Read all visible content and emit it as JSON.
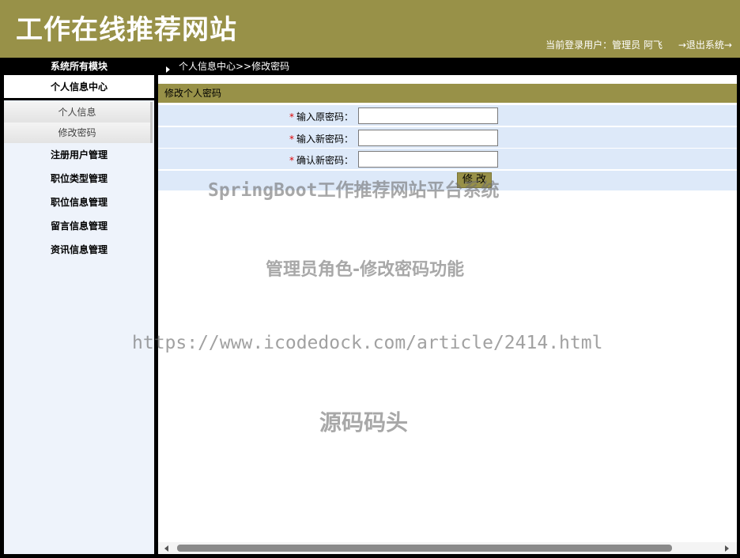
{
  "header": {
    "site_title": "工作在线推荐网站",
    "user_info": "当前登录用户：管理员 阿飞",
    "logout": "→退出系统→"
  },
  "sidebar": {
    "title": "系统所有模块",
    "active_group": "个人信息中心",
    "sub_items": [
      "个人信息",
      "修改密码"
    ],
    "groups": [
      "注册用户管理",
      "职位类型管理",
      "职位信息管理",
      "留言信息管理",
      "资讯信息管理"
    ]
  },
  "breadcrumb": "个人信息中心>>修改密码",
  "form": {
    "title": "修改个人密码",
    "required_mark": "*",
    "fields": [
      {
        "label": "输入原密码：",
        "value": ""
      },
      {
        "label": "输入新密码：",
        "value": ""
      },
      {
        "label": "确认新密码：",
        "value": ""
      }
    ],
    "submit_label": "修 改"
  },
  "watermarks": [
    "SpringBoot工作推荐网站平台系统",
    "管理员角色-修改密码功能",
    "https://www.icodedock.com/article/2414.html",
    "源码码头"
  ],
  "colors": {
    "accent": "#989148",
    "form_row_bg": "#dde9f9",
    "sidebar_bg": "#eef3fb"
  }
}
